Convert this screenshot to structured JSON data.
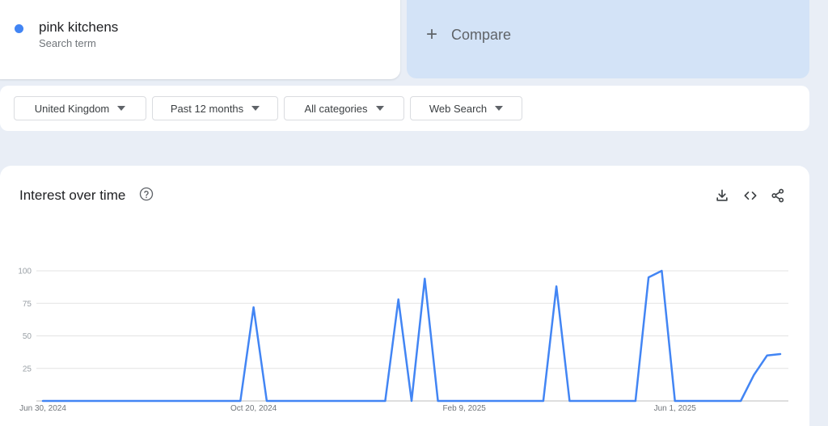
{
  "search_term": {
    "name": "pink kitchens",
    "type_label": "Search term",
    "color": "#4285f4"
  },
  "compare": {
    "label": "Compare"
  },
  "filters": {
    "region": "United Kingdom",
    "time_range": "Past 12 months",
    "category": "All categories",
    "search_type": "Web Search"
  },
  "interest_panel": {
    "title": "Interest over time",
    "icons": [
      "help-icon",
      "download-icon",
      "embed-code-icon",
      "share-icon"
    ]
  },
  "chart_data": {
    "type": "line",
    "title": "Interest over time",
    "ylim": [
      0,
      100
    ],
    "y_ticks": [
      25,
      50,
      75,
      100
    ],
    "x_tick_labels": [
      "Jun 30, 2024",
      "Oct 20, 2024",
      "Feb 9, 2025",
      "Jun 1, 2025"
    ],
    "x_tick_indices": [
      0,
      16,
      32,
      48
    ],
    "grid": true,
    "series": [
      {
        "name": "pink kitchens",
        "color": "#4285f4",
        "values": [
          0,
          0,
          0,
          0,
          0,
          0,
          0,
          0,
          0,
          0,
          0,
          0,
          0,
          0,
          0,
          0,
          72,
          0,
          0,
          0,
          0,
          0,
          0,
          0,
          0,
          0,
          0,
          78,
          0,
          94,
          0,
          0,
          0,
          0,
          0,
          0,
          0,
          0,
          0,
          88,
          0,
          0,
          0,
          0,
          0,
          0,
          95,
          100,
          0,
          0,
          0,
          0,
          0,
          0,
          20,
          35,
          36
        ]
      }
    ]
  }
}
